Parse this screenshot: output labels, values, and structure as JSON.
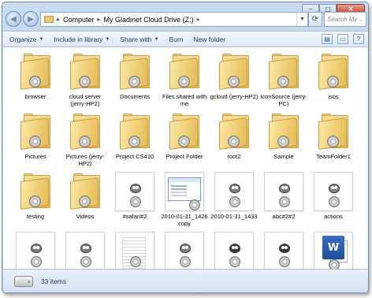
{
  "window": {
    "controls": {
      "minimize": "–",
      "maximize": "▢",
      "close": "✕"
    }
  },
  "address": {
    "crumbs": [
      "Computer",
      "My Gladinet Cloud Drive (Z:)"
    ],
    "separator": "▸"
  },
  "search": {
    "placeholder": "Search My ..."
  },
  "toolbar": {
    "organize": "Organize",
    "include_in_library": "Include in library",
    "share_with": "Share with",
    "burn": "Burn",
    "new_folder": "New folder"
  },
  "items": [
    {
      "label": "browser",
      "kind": "folder"
    },
    {
      "label": "cloud server (jerry-HP2)",
      "kind": "folder"
    },
    {
      "label": "Documents",
      "kind": "folder"
    },
    {
      "label": "Files shared with me",
      "kind": "folder"
    },
    {
      "label": "gcloud (jerry-HP2)",
      "kind": "folder"
    },
    {
      "label": "IconSource (jerry-PC)",
      "kind": "folder"
    },
    {
      "label": "isos",
      "kind": "folder"
    },
    {
      "label": "Pictures",
      "kind": "folder"
    },
    {
      "label": "Pictures (jerry-HP2)",
      "kind": "folder"
    },
    {
      "label": "Project CS410",
      "kind": "folder"
    },
    {
      "label": "Project Folder",
      "kind": "folder"
    },
    {
      "label": "root2",
      "kind": "folder"
    },
    {
      "label": "Sample",
      "kind": "folder"
    },
    {
      "label": "TeamFolder1",
      "kind": "folder"
    },
    {
      "label": "testing",
      "kind": "folder"
    },
    {
      "label": "Videos",
      "kind": "folder"
    },
    {
      "label": "#safari#2",
      "kind": "gimp"
    },
    {
      "label": "2010-01-31_1426 copy",
      "kind": "screenshot"
    },
    {
      "label": "2010-01-31_1433",
      "kind": "gimp"
    },
    {
      "label": "abc#2#2",
      "kind": "gimp"
    },
    {
      "label": "actions",
      "kind": "gimp"
    },
    {
      "label": "",
      "kind": "gimp"
    },
    {
      "label": "",
      "kind": "gimp"
    },
    {
      "label": "",
      "kind": "doc"
    },
    {
      "label": "",
      "kind": "gimp"
    },
    {
      "label": "",
      "kind": "gimp-dark"
    },
    {
      "label": "",
      "kind": "gimp-dark"
    },
    {
      "label": "",
      "kind": "word"
    }
  ],
  "status": {
    "count": "33 items"
  }
}
